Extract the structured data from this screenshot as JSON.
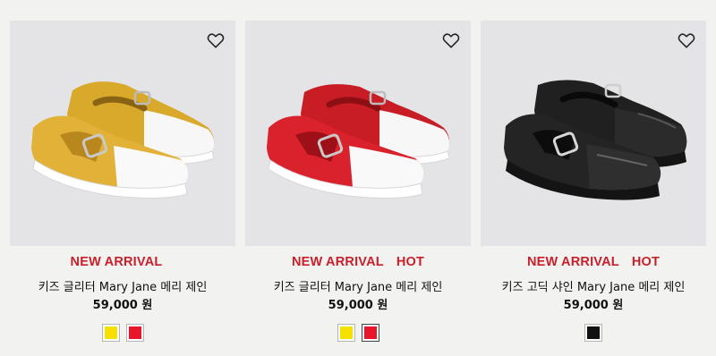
{
  "colors": {
    "badge": "#c8202a",
    "gold": "#f5e000",
    "red": "#e8162a",
    "black": "#111111"
  },
  "products": [
    {
      "badge_new": "NEW ARRIVAL",
      "badge_hot": "",
      "name": "키즈 글리터 Mary Jane 메리 제인",
      "price": "59,000 원",
      "wishlist_icon": "heart-outline-icon",
      "swatches": [
        {
          "color": "#f5e000",
          "selected": false
        },
        {
          "color": "#e8162a",
          "selected": false
        }
      ]
    },
    {
      "badge_new": "NEW ARRIVAL",
      "badge_hot": "HOT",
      "name": "키즈 글리터 Mary Jane 메리 제인",
      "price": "59,000 원",
      "wishlist_icon": "heart-outline-icon",
      "swatches": [
        {
          "color": "#f5e000",
          "selected": false
        },
        {
          "color": "#e8162a",
          "selected": true
        }
      ]
    },
    {
      "badge_new": "NEW ARRIVAL",
      "badge_hot": "HOT",
      "name": "키즈 고딕 샤인 Mary Jane 메리 제인",
      "price": "59,000 원",
      "wishlist_icon": "heart-outline-icon",
      "swatches": [
        {
          "color": "#111111",
          "selected": false
        }
      ]
    }
  ]
}
